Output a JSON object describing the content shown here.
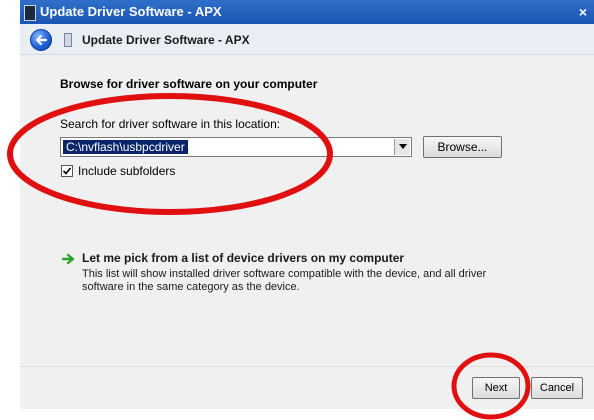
{
  "window": {
    "title": "Update Driver Software - APX",
    "close_glyph": "×"
  },
  "nav": {
    "title": "Update Driver Software - APX"
  },
  "main": {
    "heading": "Browse for driver software on your computer",
    "search_label": "Search for driver software in this location:",
    "path_value": "C:\\nvflash\\usbpcdriver",
    "browse_label": "Browse...",
    "include_subfolders_label": "Include subfolders",
    "include_subfolders_checked": true,
    "pick_link": "Let me pick from a list of device drivers on my computer",
    "pick_description": "This list will show installed driver software compatible with the device, and all driver software in the same category as the device."
  },
  "footer": {
    "next_label": "Next",
    "cancel_label": "Cancel"
  },
  "icons": {
    "back": "back-arrow-icon",
    "dropdown": "chevron-down-icon",
    "check": "checkmark-icon",
    "pick": "green-arrow-icon",
    "app": "device-icon"
  },
  "colors": {
    "title_bar": "#1a55b3",
    "selection": "#0a246a",
    "annotation": "#e01010",
    "pick_arrow": "#2aa52a"
  }
}
